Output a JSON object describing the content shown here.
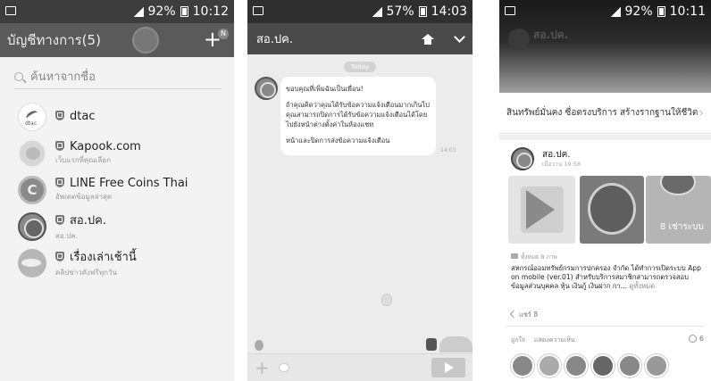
{
  "screen1": {
    "status": {
      "battery": "92%",
      "time": "10:12"
    },
    "header": {
      "title": "บัญชีทางการ(5)",
      "badge": "N"
    },
    "search": {
      "placeholder": "ค้นหาจากชื่อ"
    },
    "accounts": [
      {
        "name": "dtac",
        "sub": ""
      },
      {
        "name": "Kapook.com",
        "sub": "เว็บแรกที่คุณเลือก"
      },
      {
        "name": "LINE Free Coins Thai",
        "sub": "อัพเดตข้อมูลล่าสุด"
      },
      {
        "name": "สอ.ปค.",
        "sub": "สอ.ปค."
      },
      {
        "name": "เรื่องเล่าเช้านี้",
        "sub": "คลิปข่าวดังฟรีทุกวัน"
      }
    ]
  },
  "screen2": {
    "status": {
      "battery": "57%",
      "time": "14:03"
    },
    "header": {
      "title": "สอ.ปค."
    },
    "chat": {
      "date": "Today",
      "line1": "ขอบคุณที่เพิ่มฉันเป็นเพื่อน!",
      "line2": "ถ้าคุณคิดว่าคุณได้รับข้อความแจ้งเตือนมากเกินไป คุณสามารถปิดการได้รับข้อความแจ้งเตือนได้โดยไปยังหน้าต่างตั้งค่าในห้องแชท",
      "line3": "หน้าและปิดการส่งข้อความแจ้งเตือน",
      "time": "14:03"
    }
  },
  "screen3": {
    "status": {
      "battery": "92%",
      "time": "10:11"
    },
    "cover": {
      "sign": "สอ.ปค."
    },
    "banner": "สินทรัพย์มั่นคง ซื่อตรงบริการ สร้างรากฐานให้ชีวิต",
    "post": {
      "author": "สอ.ปค.",
      "time": "เมื่อวาน 19:58",
      "thumb_text": "8 เช่าระบบ",
      "photo_count": "ทั้งหมด 8 ภาพ",
      "body": "สหกรณ์ออมทรัพย์กรมการปกครอง จำกัด ได้ทำการเปิดระบบ App on mobile (ver.01) สำหรับบริการสมาชิกสามารถตรวจสอบข้อมูลส่วนบุคคล หุ้น เงินกู้ เงินฝาก กา...",
      "more": "ดูทั้งหมด",
      "share": "แชร์ 8",
      "like": "ถูกใจ",
      "comment": "แสดงความเห็น",
      "like_count": "6"
    }
  }
}
